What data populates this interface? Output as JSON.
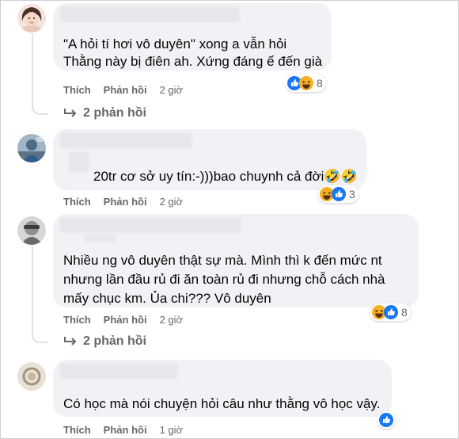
{
  "comments": [
    {
      "lines": [
        "\"A hỏi tí hơi vô duyên\" xong a vẫn hỏi",
        "Thằng này bị điên ah. Xứng đáng ế đến già"
      ],
      "like_label": "Thích",
      "reply_label": "Phản hồi",
      "time": "2 giờ",
      "reaction_icons": [
        "like-icon",
        "haha-icon"
      ],
      "reaction_count": "8",
      "replies_label": "2 phản hồi"
    },
    {
      "lines": [
        "20tr cơ sở uy tín:-)))bao chuynh cả đời🤣🤣"
      ],
      "like_label": "Thích",
      "reply_label": "Phản hồi",
      "time": "2 giờ",
      "reaction_icons": [
        "haha-icon",
        "like-icon"
      ],
      "reaction_count": "3"
    },
    {
      "lines": [
        "Nhiều ng vô duyên thật sự mà. Mình thì k đến mức nt",
        "nhưng lần đầu rủ đi ăn toàn rủ đi nhưng chỗ cách nhà",
        "mấy chục km. Ủa chi??? Vô duyên"
      ],
      "like_label": "Thích",
      "reply_label": "Phản hồi",
      "time": "2 giờ",
      "reaction_icons": [
        "haha-icon",
        "like-icon"
      ],
      "reaction_count": "8",
      "replies_label": "2 phản hồi"
    },
    {
      "lines": [
        "Có học mà nói chuyện hỏi câu như thằng vô học vậy."
      ],
      "like_label": "Thích",
      "reply_label": "Phản hồi",
      "time": "1 giờ",
      "reaction_icons": [
        "like-icon"
      ]
    }
  ],
  "colors": {
    "bubble": "#f0f2f5",
    "meta_text": "#65676b",
    "like_blue": "#1877f2",
    "haha_yellow": "#f7b125"
  }
}
